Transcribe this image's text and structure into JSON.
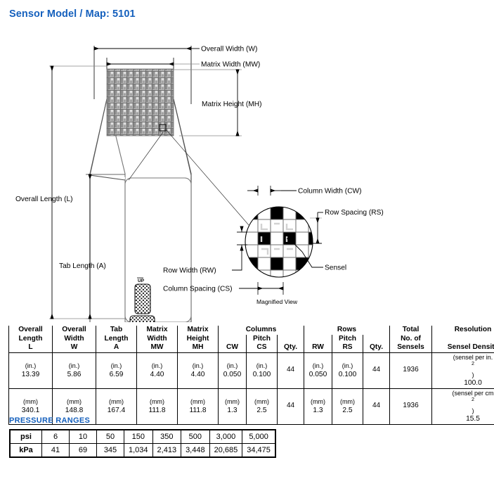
{
  "page_title": "Sensor Model / Map: 5101",
  "accent_color": "#1560bd",
  "diagram": {
    "labels": {
      "overall_width": "Overall Width (W)",
      "matrix_width": "Matrix Width (MW)",
      "matrix_height": "Matrix Height (MH)",
      "overall_length": "Overall Length (L)",
      "tab_length": "Tab Length (A)",
      "row_width": "Row Width (RW)",
      "column_spacing": "Column Spacing (CS)",
      "column_width": "Column Width (CW)",
      "row_spacing": "Row Spacing (RS)",
      "sensel": "Sensel",
      "magnified_view": "Magnified View",
      "up_marker": "UP"
    }
  },
  "spec_table": {
    "headers": {
      "overall_length": [
        "Overall",
        "Length",
        "L"
      ],
      "overall_width": [
        "Overall",
        "Width",
        "W"
      ],
      "tab_length": [
        "Tab",
        "Length",
        "A"
      ],
      "matrix_width": [
        "Matrix",
        "Width",
        "MW"
      ],
      "matrix_height": [
        "Matrix",
        "Height",
        "MH"
      ],
      "columns_group": "Columns",
      "rows_group": "Rows",
      "cw": "CW",
      "pitch_cs": [
        "Pitch",
        "CS"
      ],
      "qty_cols": "Qty.",
      "rw": "RW",
      "pitch_rs": [
        "Pitch",
        "RS"
      ],
      "qty_rows": "Qty.",
      "total_sensels": [
        "Total",
        "No. of",
        "Sensels"
      ],
      "resolution": "Resolution",
      "sensel_density": "Sensel Density"
    },
    "rows": [
      {
        "unit_label": "(in.)",
        "overall_length": "13.39",
        "overall_width": "5.86",
        "tab_length": "6.59",
        "matrix_width": "4.40",
        "matrix_height": "4.40",
        "cw": "0.050",
        "pitch_cs": "0.100",
        "qty_cols": "44",
        "rw": "0.050",
        "pitch_rs": "0.100",
        "qty_rows": "44",
        "total_sensels": "1936",
        "density_unit_pre": "(sensel per in.",
        "density_unit_sup": "2",
        "density_unit_post": ")",
        "density_value": "100.0"
      },
      {
        "unit_label": "(mm)",
        "overall_length": "340.1",
        "overall_width": "148.8",
        "tab_length": "167.4",
        "matrix_width": "111.8",
        "matrix_height": "111.8",
        "cw": "1.3",
        "pitch_cs": "2.5",
        "qty_cols": "44",
        "rw": "1.3",
        "pitch_rs": "2.5",
        "qty_rows": "44",
        "total_sensels": "1936",
        "density_unit_pre": "(sensel per cm",
        "density_unit_sup": "2",
        "density_unit_post": ")",
        "density_value": "15.5"
      }
    ]
  },
  "pressure_ranges": {
    "heading": "PRESSURE RANGES",
    "row_labels": [
      "psi",
      "kPa"
    ],
    "psi": [
      "6",
      "10",
      "50",
      "150",
      "350",
      "500",
      "3,000",
      "5,000"
    ],
    "kpa": [
      "41",
      "69",
      "345",
      "1,034",
      "2,413",
      "3,448",
      "20,685",
      "34,475"
    ]
  }
}
